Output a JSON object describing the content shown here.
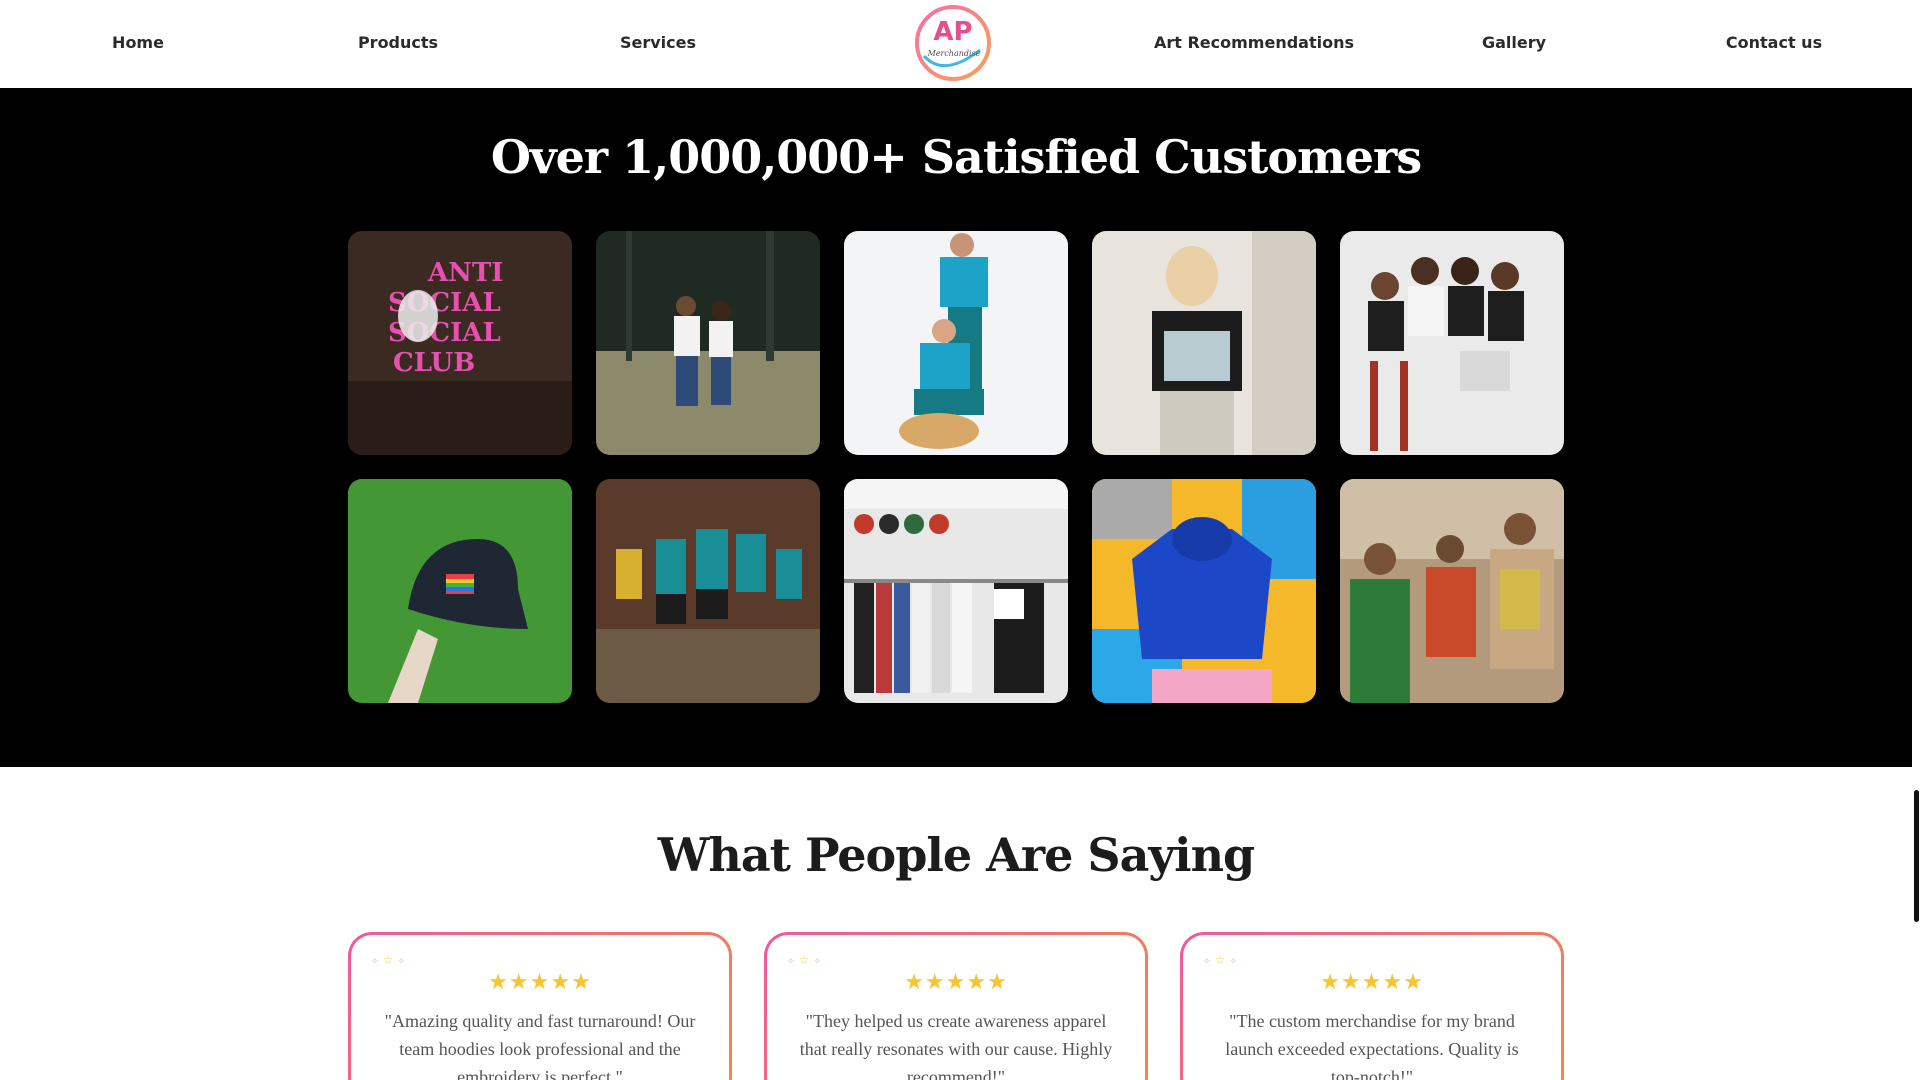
{
  "nav": {
    "items": [
      "Home",
      "Products",
      "Services",
      "Art Recommendations",
      "Gallery",
      "Contact us"
    ],
    "logo_text": "AP",
    "logo_subtext": "Merchandise"
  },
  "gallery": {
    "title": "Over 1,000,000+ Satisfied Customers",
    "photos": [
      "anti-social-club-shirt-photo",
      "couple-in-forest-photo",
      "men-with-dog-photo",
      "woman-graphic-tee-photo",
      "group-streetwear-photo",
      "rainbow-heart-cap-photo",
      "soccer-team-photo",
      "clothing-market-stall-photo",
      "blue-hoodie-photo",
      "friends-beach-shirts-photo"
    ]
  },
  "testimonials": {
    "title": "What People Are Saying",
    "rating": "★★★★★",
    "cards": [
      {
        "quote": "\"Amazing quality and fast turnaround! Our team hoodies look professional and the embroidery is perfect.\""
      },
      {
        "quote": "\"They helped us create awareness apparel that really resonates with our cause. Highly recommend!\""
      },
      {
        "quote": "\"The custom merchandise for my brand launch exceeded expectations. Quality is top-notch!\""
      }
    ]
  },
  "colors": {
    "accent_pink": "#ee5a9a",
    "accent_orange": "#f28a4c",
    "star": "#f7c531",
    "gallery_bg": "#000000"
  }
}
